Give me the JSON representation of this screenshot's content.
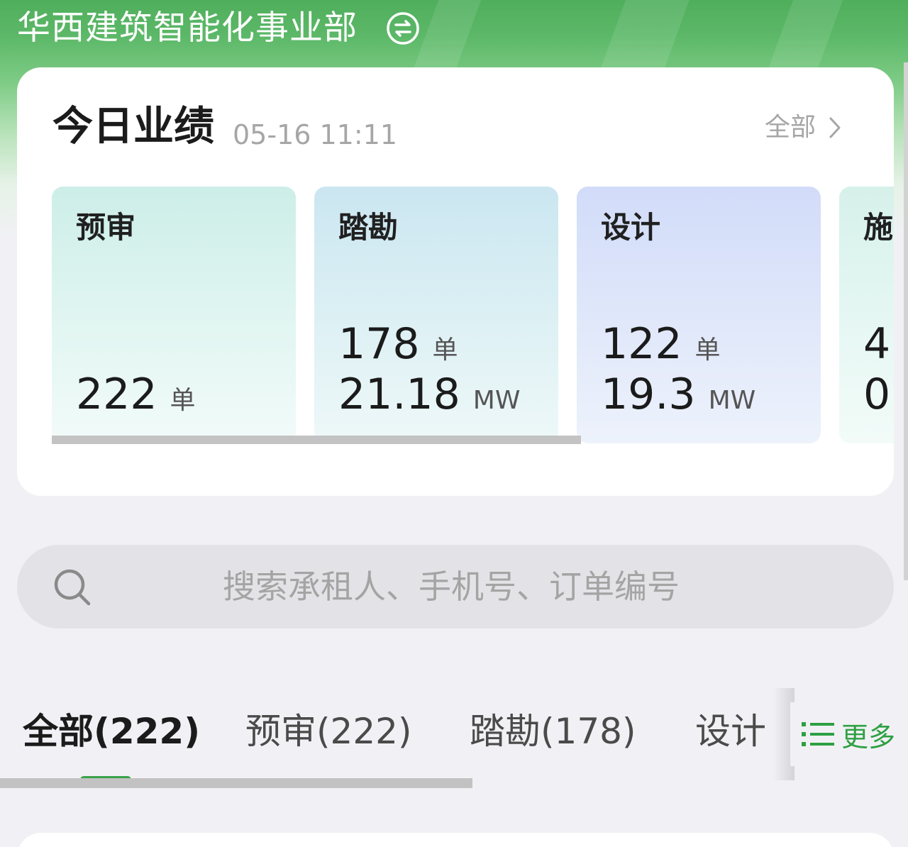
{
  "header": {
    "org_name": "华西建筑智能化事业部",
    "switch_icon": "switch-arrows-icon",
    "gradient_color": "#4fae5c"
  },
  "performance": {
    "title": "今日业绩",
    "datetime": "05-16 11:11",
    "all_label": "全部",
    "cards": [
      {
        "label": "预审",
        "lines": [
          {
            "value": "222",
            "unit": "单"
          }
        ]
      },
      {
        "label": "踏勘",
        "lines": [
          {
            "value": "178",
            "unit": "单"
          },
          {
            "value": "21.18",
            "unit": "MW"
          }
        ]
      },
      {
        "label": "设计",
        "lines": [
          {
            "value": "122",
            "unit": "单"
          },
          {
            "value": "19.3",
            "unit": "MW"
          }
        ]
      },
      {
        "label": "施",
        "lines": [
          {
            "value": "4",
            "unit": ""
          },
          {
            "value": "0.",
            "unit": ""
          }
        ]
      }
    ]
  },
  "search": {
    "placeholder": "搜索承租人、手机号、订单编号"
  },
  "tabs": {
    "items": [
      {
        "label": "全部(222)",
        "active": true
      },
      {
        "label": "预审(222)",
        "active": false
      },
      {
        "label": "踏勘(178)",
        "active": false
      },
      {
        "label": "设计",
        "active": false
      }
    ],
    "more_label": "更多",
    "accent_color": "#2ea043"
  }
}
